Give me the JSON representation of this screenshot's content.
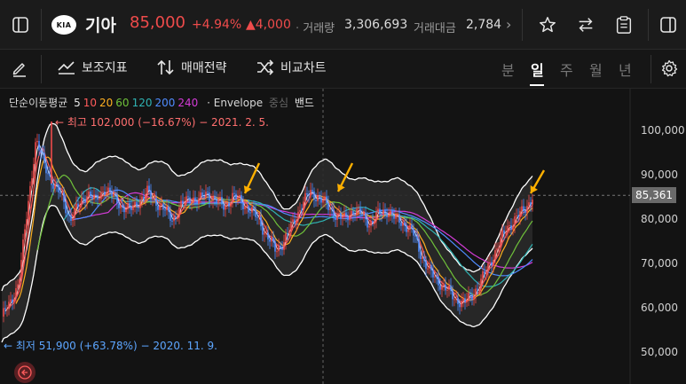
{
  "header": {
    "stock_name": "기아",
    "logo_text": "KIA",
    "price": "85,000",
    "change_pct": "+4.94%",
    "change_amt": "▲4,000",
    "volume_label": "거래량",
    "volume": "3,306,693",
    "amount_label": "거래대금",
    "amount": "2,784"
  },
  "toolbar": {
    "secondary_indicator": "보조지표",
    "trade_strategy": "매매전략",
    "compare_chart": "비교차트",
    "periods": [
      "분",
      "일",
      "주",
      "월",
      "년"
    ],
    "active_period": "일"
  },
  "legend": {
    "ma_label": "단순이동평균",
    "ma_periods": [
      {
        "text": "5",
        "color": "#e8e8e8"
      },
      {
        "text": "10",
        "color": "#ff5b5b"
      },
      {
        "text": "20",
        "color": "#ffb020"
      },
      {
        "text": "60",
        "color": "#6fc13a"
      },
      {
        "text": "120",
        "color": "#2fb3b3"
      },
      {
        "text": "200",
        "color": "#4f8cff"
      },
      {
        "text": "240",
        "color": "#d23bd6"
      }
    ],
    "envelope_label": "· Envelope",
    "envelope_mid": "중심",
    "envelope_band": "밴드"
  },
  "chart": {
    "high_label": "← 최고 102,000 (−16.67%) − 2021. 2. 5.",
    "low_label": "← 최저 51,900 (+63.78%) − 2020. 11. 9.",
    "current_price_tag": "85,361",
    "y_ticks": [
      "100,000",
      "90,000",
      "80,000",
      "70,000",
      "60,000",
      "50,000"
    ],
    "colors": {
      "up": "#ef4b4b",
      "down": "#4f8cff",
      "band": "#ffffff",
      "arrow": "#ffb000"
    }
  },
  "chart_data": {
    "type": "candlestick",
    "series_names": [
      "5",
      "10",
      "20",
      "60",
      "120",
      "200",
      "240",
      "Envelope"
    ],
    "ylim": [
      45000,
      105000
    ],
    "y_ticks": [
      50000,
      60000,
      70000,
      80000,
      90000,
      100000
    ],
    "high": 102000,
    "low": 51900,
    "current": 85361,
    "close_series": [
      58000,
      61000,
      66000,
      82000,
      98000,
      92000,
      88000,
      85000,
      80000,
      83000,
      86000,
      84000,
      87000,
      85000,
      83000,
      82000,
      84000,
      86000,
      84000,
      82000,
      80000,
      83000,
      85000,
      84000,
      86000,
      84000,
      83000,
      85000,
      84000,
      82000,
      80000,
      76000,
      73000,
      75000,
      79000,
      83000,
      86000,
      85000,
      83000,
      81000,
      80000,
      82000,
      81000,
      79000,
      81000,
      82000,
      80000,
      79000,
      77000,
      72000,
      68000,
      66000,
      64000,
      62000,
      61000,
      63000,
      66000,
      70000,
      74000,
      78000,
      80000,
      82000,
      85000
    ]
  }
}
